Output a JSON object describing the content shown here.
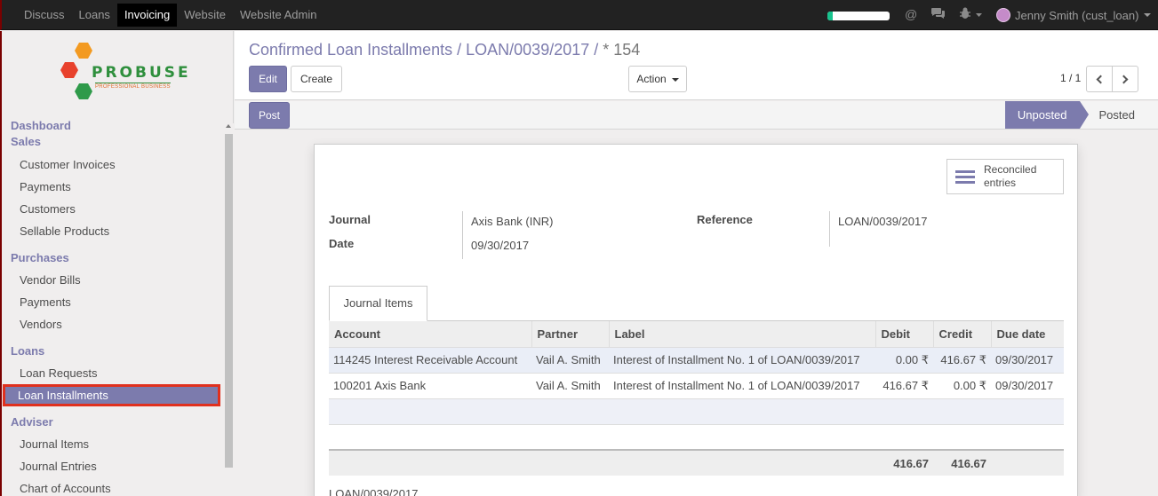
{
  "topbar": {
    "menu": [
      "Discuss",
      "Loans",
      "Invoicing",
      "Website",
      "Website Admin"
    ],
    "active_menu": "Invoicing",
    "progress": 0.08,
    "user": "Jenny Smith (cust_loan)"
  },
  "logo": {
    "name": "PROBUSE",
    "tagline": "PROFESSIONAL BUSINESS"
  },
  "sidebar": {
    "sections": [
      {
        "title": "Dashboard",
        "items": []
      },
      {
        "title": "Sales",
        "items": [
          "Customer Invoices",
          "Payments",
          "Customers",
          "Sellable Products"
        ]
      },
      {
        "title": "Purchases",
        "items": [
          "Vendor Bills",
          "Payments",
          "Vendors"
        ]
      },
      {
        "title": "Loans",
        "items": [
          "Loan Requests",
          "Loan Installments"
        ]
      },
      {
        "title": "Adviser",
        "items": [
          "Journal Items",
          "Journal Entries",
          "Chart of Accounts"
        ]
      }
    ],
    "active_item": "Loan Installments"
  },
  "breadcrumb": {
    "parts": [
      "Confirmed Loan Installments",
      "LOAN/0039/2017"
    ],
    "current": "* 154"
  },
  "toolbar": {
    "edit": "Edit",
    "create": "Create",
    "action": "Action",
    "pager": "1 / 1"
  },
  "statusbar": {
    "post": "Post",
    "stages": [
      "Unposted",
      "Posted"
    ],
    "current_stage": "Unposted"
  },
  "form": {
    "smart_button": "Reconciled entries",
    "journal_label": "Journal",
    "journal": "Axis Bank (INR)",
    "date_label": "Date",
    "date": "09/30/2017",
    "reference_label": "Reference",
    "reference": "LOAN/0039/2017",
    "tab": "Journal Items",
    "columns": [
      "Account",
      "Partner",
      "Label",
      "Debit",
      "Credit",
      "Due date"
    ],
    "rows": [
      {
        "account": "114245 Interest Receivable Account",
        "partner": "Vail A. Smith",
        "label": "Interest of Installment No. 1 of LOAN/0039/2017",
        "debit": "0.00 ₹",
        "credit": "416.67 ₹",
        "due": "09/30/2017"
      },
      {
        "account": "100201 Axis Bank",
        "partner": "Vail A. Smith",
        "label": "Interest of Installment No. 1 of LOAN/0039/2017",
        "debit": "416.67 ₹",
        "credit": "0.00 ₹",
        "due": "09/30/2017"
      }
    ],
    "total_debit": "416.67",
    "total_credit": "416.67",
    "narration": "LOAN/0039/2017"
  },
  "colors": {
    "brand": "#7c7bad",
    "topbar": "#222222",
    "highlight": "#e0301e"
  }
}
